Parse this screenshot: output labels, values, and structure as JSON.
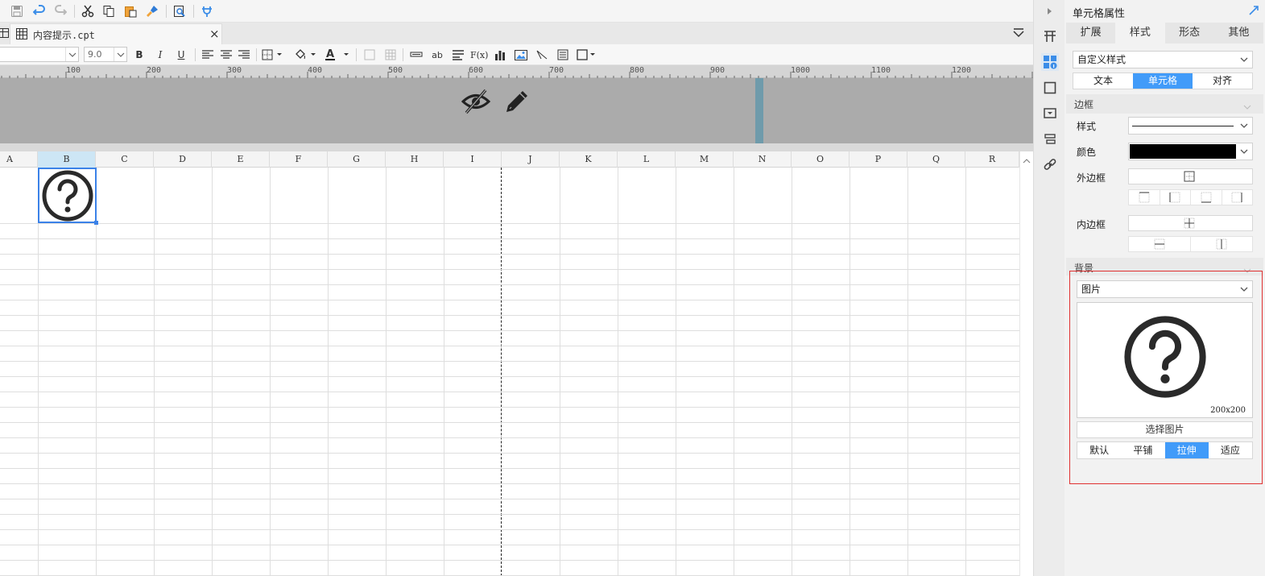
{
  "toolbar": {
    "icons": [
      "save-icon",
      "undo-icon",
      "redo-icon",
      "cut-icon",
      "copy-icon",
      "paste-icon",
      "format-brush-icon",
      "preview-icon",
      "plugin-icon"
    ]
  },
  "tab": {
    "filename": "内容提示.cpt",
    "close": "×"
  },
  "format": {
    "font_size": "9.0",
    "bold": "B",
    "italic": "I",
    "underline": "U",
    "text_label": "ab",
    "fx_label": "F(x)"
  },
  "ruler": {
    "labels": [
      "100",
      "200",
      "300",
      "400",
      "500",
      "600",
      "700",
      "800",
      "900",
      "1000",
      "1100",
      "1200"
    ]
  },
  "columns": [
    "A",
    "B",
    "C",
    "D",
    "E",
    "F",
    "G",
    "H",
    "I",
    "J",
    "K",
    "L",
    "M",
    "N",
    "O",
    "P",
    "Q",
    "R"
  ],
  "selected_column": "B",
  "panel": {
    "title": "单元格属性",
    "tabs": [
      "扩展",
      "样式",
      "形态",
      "其他"
    ],
    "active_tab": "样式",
    "style_select": "自定义样式",
    "sub_tabs": [
      "文本",
      "单元格",
      "对齐"
    ],
    "active_sub_tab": "单元格",
    "border_section": "边框",
    "style_label": "样式",
    "color_label": "颜色",
    "outer_border_label": "外边框",
    "inner_border_label": "内边框",
    "background_section": "背景",
    "background_type": "图片",
    "image_size": "200x200",
    "choose_image": "选择图片",
    "layout_options": [
      "默认",
      "平铺",
      "拉伸",
      "适应"
    ],
    "active_layout": "拉伸",
    "color_swatch": "#000000",
    "accent": "#419bf9",
    "highlight_border": "#e03131"
  }
}
